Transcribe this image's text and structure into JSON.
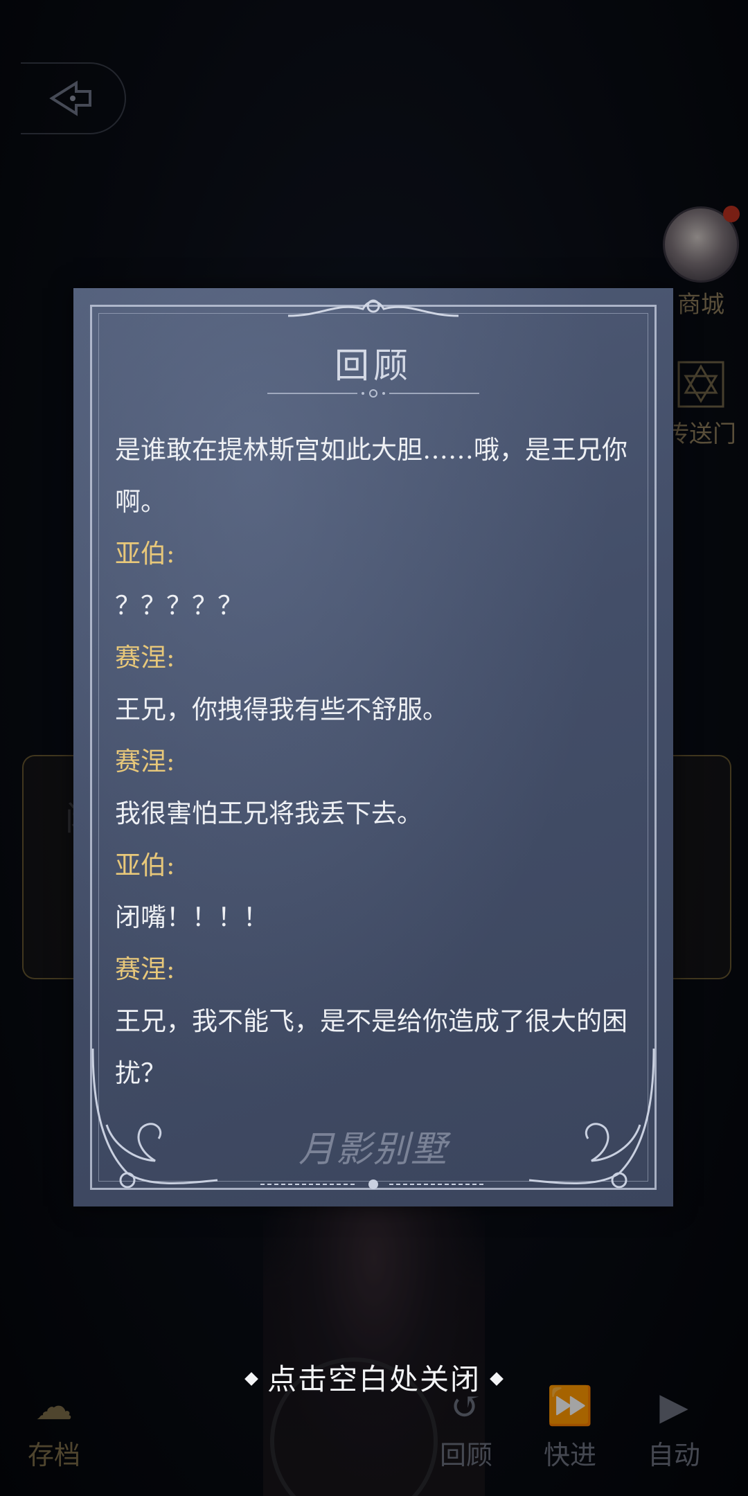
{
  "side_menu": {
    "shop_label": "商城",
    "portal_label": "传送门"
  },
  "bottom_bar": {
    "save_label": "存档",
    "review_label": "回顾",
    "fast_forward_label": "快进",
    "auto_label": "自动"
  },
  "background_dialog": {
    "name_text": "闭"
  },
  "review": {
    "title": "回顾",
    "logo_text": "月影别墅",
    "entries": [
      {
        "kind": "line",
        "text": "是谁敢在提林斯宫如此大胆……哦，是王兄你"
      },
      {
        "kind": "line",
        "text": "啊。"
      },
      {
        "kind": "speaker",
        "text": "亚伯:"
      },
      {
        "kind": "line",
        "text": "？？？？？"
      },
      {
        "kind": "speaker",
        "text": "赛涅:"
      },
      {
        "kind": "line",
        "text": "王兄，你拽得我有些不舒服。"
      },
      {
        "kind": "speaker",
        "text": "赛涅:"
      },
      {
        "kind": "line",
        "text": "我很害怕王兄将我丢下去。"
      },
      {
        "kind": "speaker",
        "text": "亚伯:"
      },
      {
        "kind": "line",
        "text": "闭嘴！！！！"
      },
      {
        "kind": "speaker",
        "text": "赛涅:"
      },
      {
        "kind": "line",
        "text": "王兄，我不能飞，是不是给你造成了很大的困"
      },
      {
        "kind": "line",
        "text": "扰？"
      }
    ]
  },
  "close_hint": "点击空白处关闭",
  "colors": {
    "speaker": "#e8c87a",
    "panel": "#4a5570",
    "text": "#eef0f4"
  },
  "icons": {
    "back": "back-arrow-icon",
    "portal": "hexagram-icon",
    "save": "cloud-save-icon",
    "review": "rewind-icon",
    "fast_forward": "fast-forward-icon",
    "auto": "play-icon"
  }
}
